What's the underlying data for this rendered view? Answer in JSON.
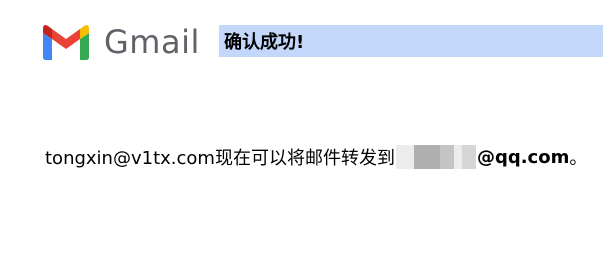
{
  "header": {
    "logo_text": "Gmail",
    "logo_colors": {
      "red": "#ea4335",
      "blue": "#4285f4",
      "green": "#34a853",
      "yellow": "#fbbc04",
      "dark_red": "#c5221f",
      "wordmark": "#5f6368"
    },
    "banner_text": "确认成功!",
    "banner_color": "#c2d7fa"
  },
  "message": {
    "prefix": "tongxin@v1tx.com现在可以将邮件转发到",
    "redacted_icon": "redacted-block",
    "domain": "@qq.com",
    "suffix": "。"
  }
}
